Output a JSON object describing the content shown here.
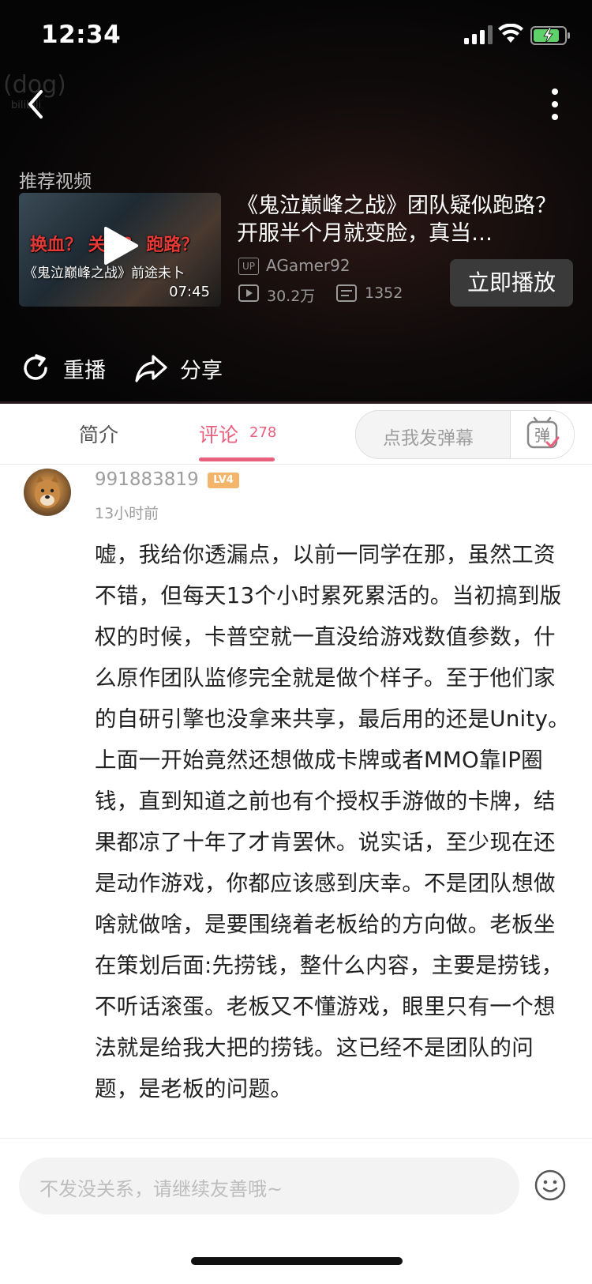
{
  "status_bar": {
    "time": "12:34"
  },
  "player": {
    "watermark": "(dog)",
    "watermark_small": "bilibili",
    "recommend_label": "推荐视频",
    "recommended": {
      "thumbnail_tags": "换血？ 关门？ 跑路？",
      "thumbnail_subtitle": "《鬼泣巅峰之战》前途未卜",
      "duration": "07:45",
      "title": "《鬼泣巅峰之战》团队疑似跑路？开服半个月就变脸，真当…",
      "up_badge": "UP",
      "up_name": "AGamer92",
      "views": "30.2万",
      "danmaku_count": "1352"
    },
    "play_now_label": "立即播放",
    "replay_label": "重播",
    "share_label": "分享"
  },
  "tabs": {
    "intro_label": "简介",
    "comment_label": "评论",
    "comment_count": "278",
    "danmaku_placeholder": "点我发弹幕",
    "danmaku_icon_text": "弹"
  },
  "comment": {
    "username": "991883819",
    "level": "LV4",
    "time_ago": "13小时前",
    "text": "嘘，我给你透漏点，以前一同学在那，虽然工资不错，但每天13个小时累死累活的。当初搞到版权的时候，卡普空就一直没给游戏数值参数，什么原作团队监修完全就是做个样子。至于他们家的自研引擎也没拿来共享，最后用的还是Unity。上面一开始竟然还想做成卡牌或者MMO靠IP圈钱，直到知道之前也有个授权手游做的卡牌，结果都凉了十年了才肯罢休。说实话，至少现在还是动作游戏，你都应该感到庆幸。不是团队想做啥就做啥，是要围绕着老板给的方向做。老板坐在策划后面:先捞钱，整什么内容，主要是捞钱，不听话滚蛋。老板又不懂游戏，眼里只有一个想法就是给我大把的捞钱。这已经不是团队的问题，是老板的问题。"
  },
  "input": {
    "placeholder": "不发没关系，请继续友善哦~"
  },
  "colors": {
    "accent_pink": "#e9607f",
    "level_orange": "#f3b569"
  }
}
